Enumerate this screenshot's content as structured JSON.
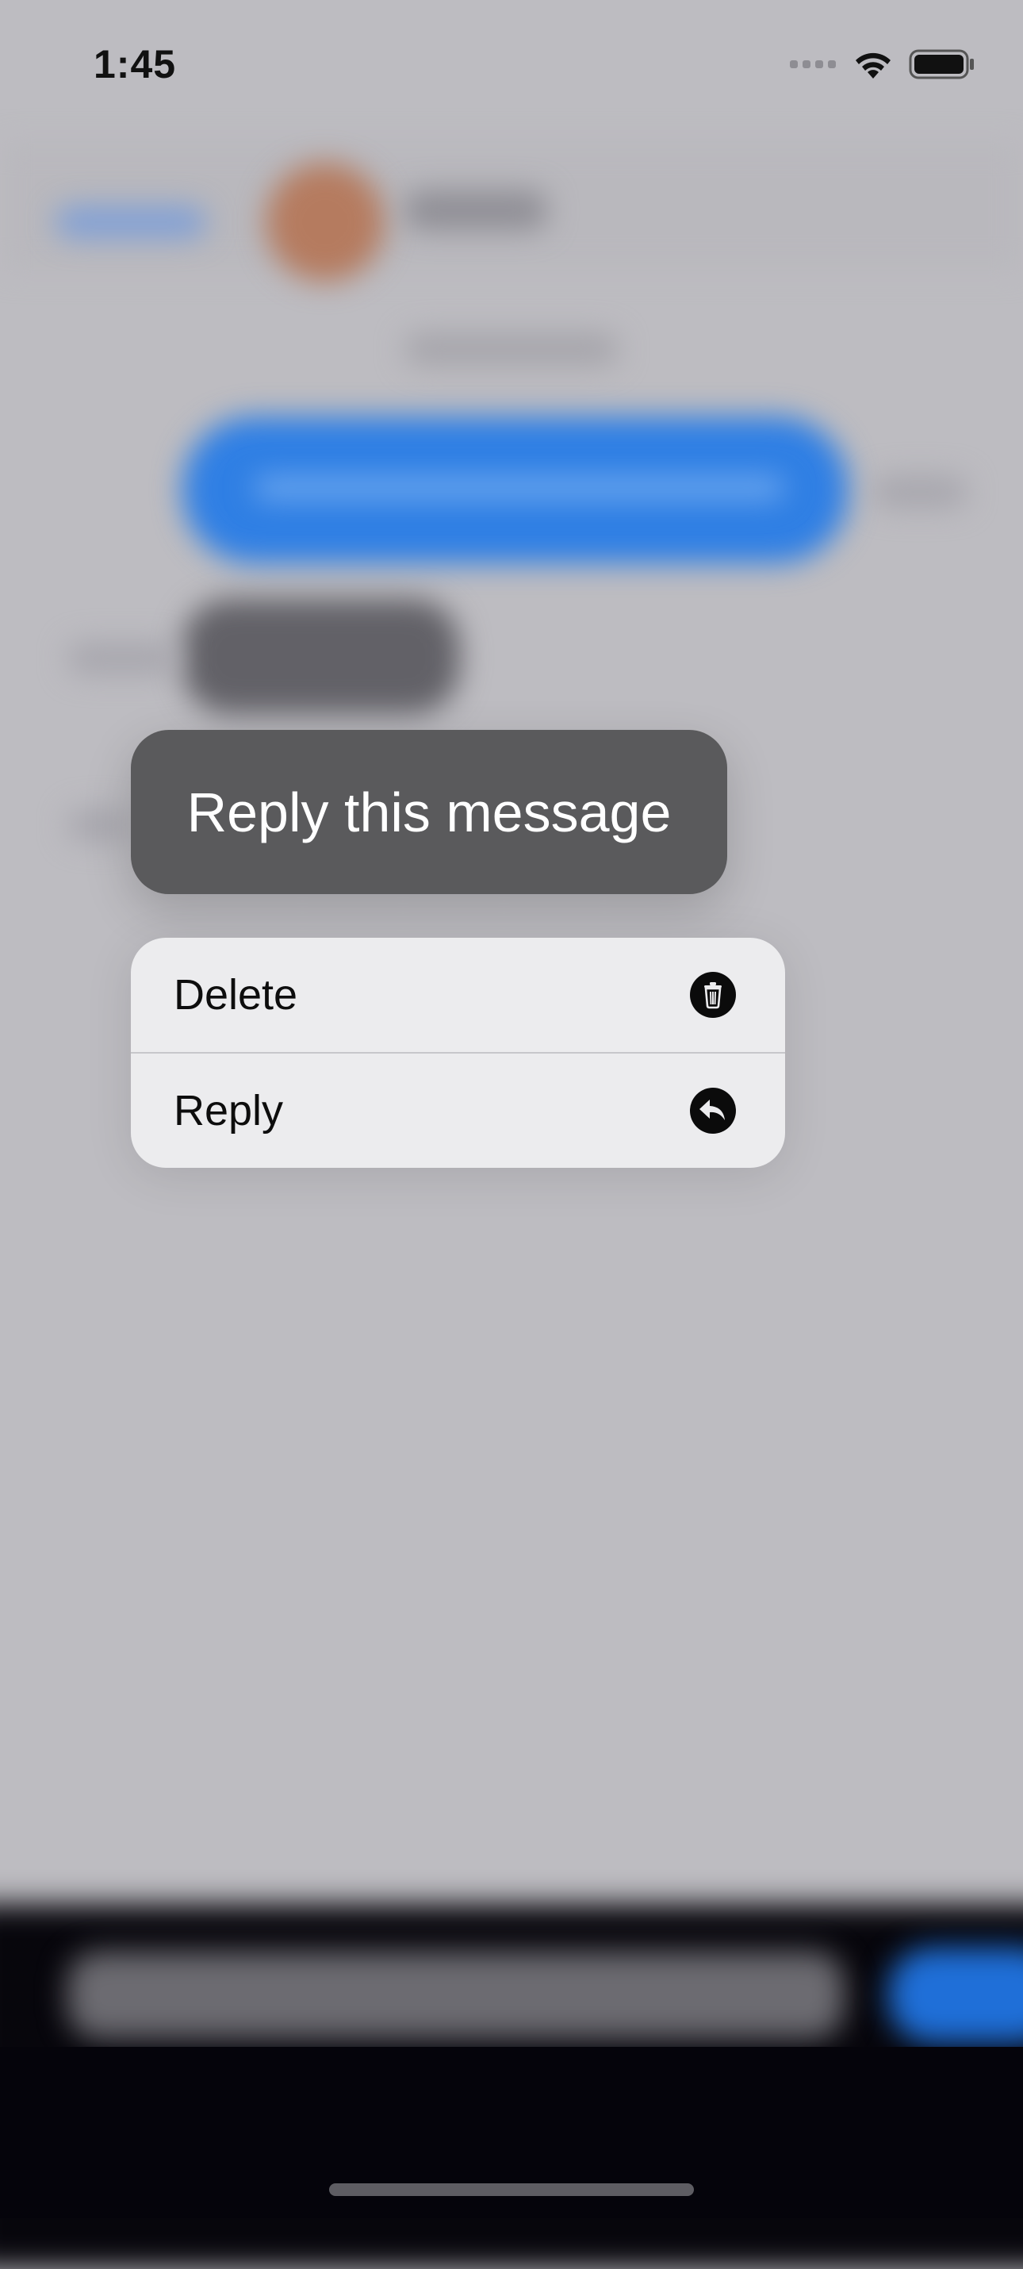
{
  "status_bar": {
    "time": "1:45",
    "icons": [
      "cellular-signal-icon",
      "wifi-icon",
      "battery-icon"
    ]
  },
  "message_preview": {
    "text": "Reply this message"
  },
  "context_menu": {
    "items": [
      {
        "label": "Delete",
        "icon": "trash-icon"
      },
      {
        "label": "Reply",
        "icon": "reply-arrow-icon"
      }
    ]
  },
  "colors": {
    "backdrop": "#bdbcc1",
    "preview_bubble": "#5a5a5c",
    "menu_background": "#ececee",
    "menu_text": "#0d0d0d"
  }
}
